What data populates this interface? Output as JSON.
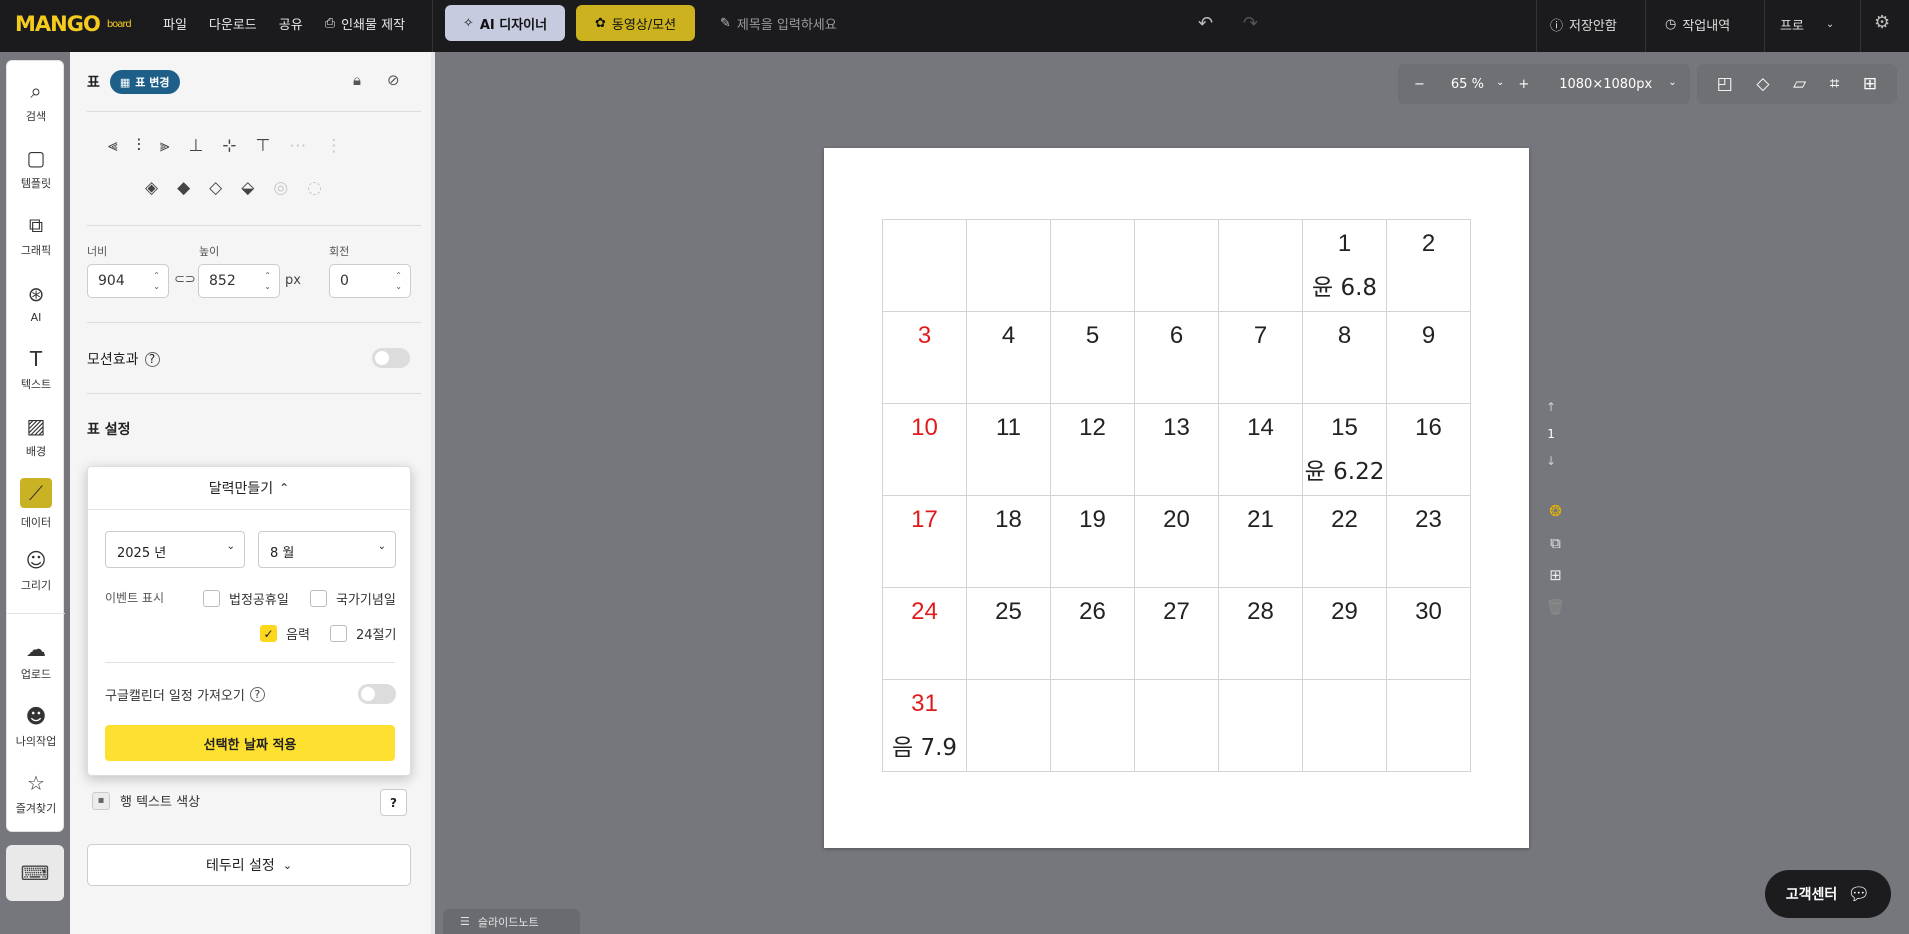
{
  "topbar": {
    "logo": "MANGO",
    "logo_suffix": "board",
    "menu": [
      "파일",
      "다운로드",
      "공유",
      "인쇄물 제작"
    ],
    "ai_designer": "AI 디자이너",
    "video_motion": "동영상/모션",
    "title_placeholder": "제목을 입력하세요",
    "unsaved": "저장안함",
    "history": "작업내역",
    "plan": "프로"
  },
  "sidebar": {
    "items": [
      {
        "label": "검색",
        "icon": "search-icon"
      },
      {
        "label": "템플릿",
        "icon": "template-icon"
      },
      {
        "label": "그래픽",
        "icon": "graphic-icon"
      },
      {
        "label": "AI",
        "icon": "ai-icon"
      },
      {
        "label": "텍스트",
        "icon": "text-icon"
      },
      {
        "label": "배경",
        "icon": "background-icon"
      },
      {
        "label": "데이터",
        "icon": "chart-icon"
      },
      {
        "label": "그리기",
        "icon": "draw-icon"
      },
      {
        "label": "업로드",
        "icon": "upload-icon"
      },
      {
        "label": "나의작업",
        "icon": "my-work-icon"
      },
      {
        "label": "즐겨찾기",
        "icon": "favorite-icon"
      }
    ],
    "active_color": "#c9b223"
  },
  "panel": {
    "title": "표",
    "change_tag": "표 변경",
    "width_label": "너비",
    "width_value": "904",
    "height_label": "높이",
    "height_value": "852",
    "unit": "px",
    "rotate_label": "회전",
    "rotate_value": "0",
    "motion_label": "모션효과",
    "table_settings": "표 설정",
    "row_text_color": "행 텍스트 색상",
    "help": "?",
    "border_settings": "테두리 설정"
  },
  "calendar_popup": {
    "title": "달력만들기",
    "year": "2025 년",
    "month": "8 월",
    "event_label": "이벤트 표시",
    "checkboxes": [
      {
        "label": "법정공휴일",
        "checked": false
      },
      {
        "label": "국가기념일",
        "checked": false
      },
      {
        "label": "음력",
        "checked": true
      },
      {
        "label": "24절기",
        "checked": false
      }
    ],
    "google_import": "구글캘린더 일정 가져오기",
    "apply": "선택한 날짜 적용",
    "accent_color": "#fee030"
  },
  "zoom": {
    "minus": "−",
    "value": "65 %",
    "plus": "+",
    "size": "1080×1080px"
  },
  "page_indicator": "1",
  "calendar": {
    "rows": [
      [
        {
          "d": ""
        },
        {
          "d": ""
        },
        {
          "d": ""
        },
        {
          "d": ""
        },
        {
          "d": ""
        },
        {
          "d": "1",
          "ev": "윤 6.8"
        },
        {
          "d": "2"
        }
      ],
      [
        {
          "d": "3"
        },
        {
          "d": "4"
        },
        {
          "d": "5"
        },
        {
          "d": "6"
        },
        {
          "d": "7"
        },
        {
          "d": "8"
        },
        {
          "d": "9"
        }
      ],
      [
        {
          "d": "10"
        },
        {
          "d": "11"
        },
        {
          "d": "12"
        },
        {
          "d": "13"
        },
        {
          "d": "14"
        },
        {
          "d": "15",
          "ev": "윤 6.22"
        },
        {
          "d": "16"
        }
      ],
      [
        {
          "d": "17"
        },
        {
          "d": "18"
        },
        {
          "d": "19"
        },
        {
          "d": "20"
        },
        {
          "d": "21"
        },
        {
          "d": "22"
        },
        {
          "d": "23"
        }
      ],
      [
        {
          "d": "24"
        },
        {
          "d": "25"
        },
        {
          "d": "26"
        },
        {
          "d": "27"
        },
        {
          "d": "28"
        },
        {
          "d": "29"
        },
        {
          "d": "30"
        }
      ],
      [
        {
          "d": "31",
          "ev": "음 7.9"
        },
        {
          "d": ""
        },
        {
          "d": ""
        },
        {
          "d": ""
        },
        {
          "d": ""
        },
        {
          "d": ""
        },
        {
          "d": ""
        }
      ]
    ],
    "sunday_color": "#e01b1b"
  },
  "slide_note": "슬라이드노트",
  "customer_center": "고객센터"
}
